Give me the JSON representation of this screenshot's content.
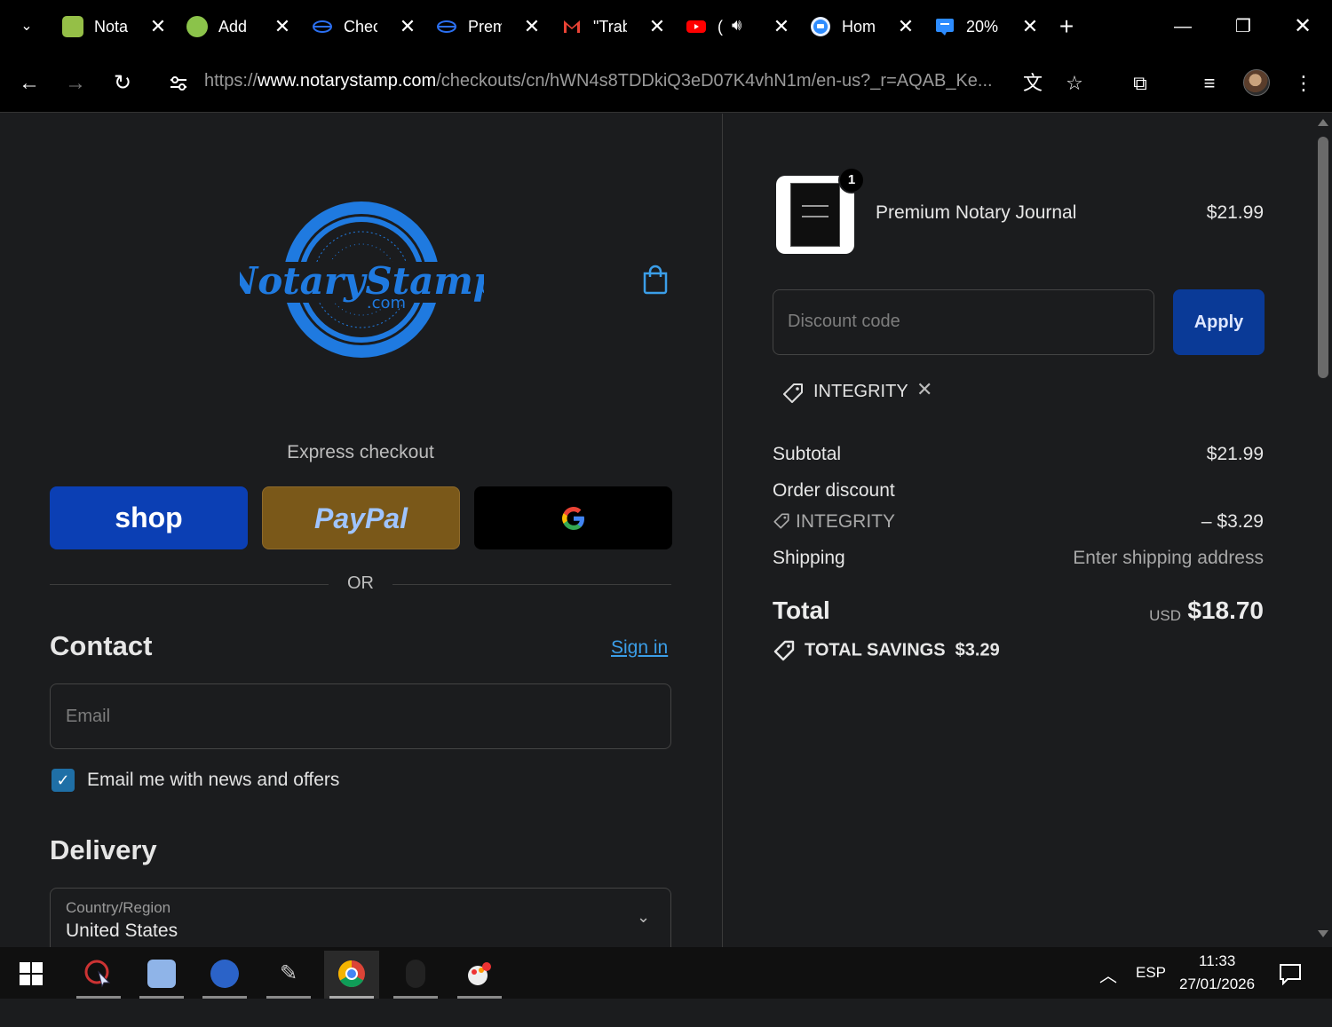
{
  "browser": {
    "tabs": [
      {
        "label": "Nota",
        "icon": "shopify-icon",
        "color": "#95bf47"
      },
      {
        "label": "Add",
        "icon": "add-icon",
        "color": "#8bc34a"
      },
      {
        "label": "Chec",
        "icon": "globe-icon",
        "color": "#2b6ff0"
      },
      {
        "label": "Prem",
        "icon": "globe-icon",
        "color": "#2b6ff0"
      },
      {
        "label": "\"Trab",
        "icon": "gmail-icon",
        "color": "#ea4335"
      },
      {
        "label": "(",
        "icon": "youtube-icon",
        "color": "#ff0000"
      },
      {
        "label": "Hom",
        "icon": "chat-icon",
        "color": "#2d8cff"
      },
      {
        "label": "20%",
        "icon": "chat-icon",
        "color": "#2d8cff"
      }
    ],
    "url_prefix": "https://",
    "url_host": "www.notarystamp.com",
    "url_path": "/checkouts/cn/hWN4s8TDDkiQ3eD07K4vhN1m/en-us?_r=AQAB_Ke..."
  },
  "left": {
    "logo_text": "NotaryStamp",
    "logo_sub": ".com",
    "express_title": "Express checkout",
    "shop_label": "shop",
    "paypal_label": "PayPal",
    "or_label": "OR",
    "contact_title": "Contact",
    "signin_label": "Sign in",
    "email_placeholder": "Email",
    "newsletter_label": "Email me with news and offers",
    "delivery_title": "Delivery",
    "country_label": "Country/Region",
    "country_value": "United States"
  },
  "right": {
    "product": {
      "name": "Premium Notary Journal",
      "price": "$21.99",
      "qty": "1"
    },
    "discount_placeholder": "Discount code",
    "apply_label": "Apply",
    "applied_code": "INTEGRITY",
    "subtotal_label": "Subtotal",
    "subtotal_value": "$21.99",
    "order_discount_label": "Order discount",
    "discount_code": "INTEGRITY",
    "discount_value": "– $3.29",
    "shipping_label": "Shipping",
    "shipping_value": "Enter shipping address",
    "total_label": "Total",
    "currency": "USD",
    "total_value": "$18.70",
    "savings_label": "TOTAL SAVINGS",
    "savings_value": "$3.29"
  },
  "taskbar": {
    "lang": "ESP",
    "time": "11:33",
    "date": "27/01/2026"
  },
  "colors": {
    "accent": "#3b9ee8",
    "shop_blue": "#0b3fb4",
    "paypal_gold": "#7a5819",
    "apply_blue": "#0a3a97",
    "logo_blue": "#1f7ae0"
  }
}
